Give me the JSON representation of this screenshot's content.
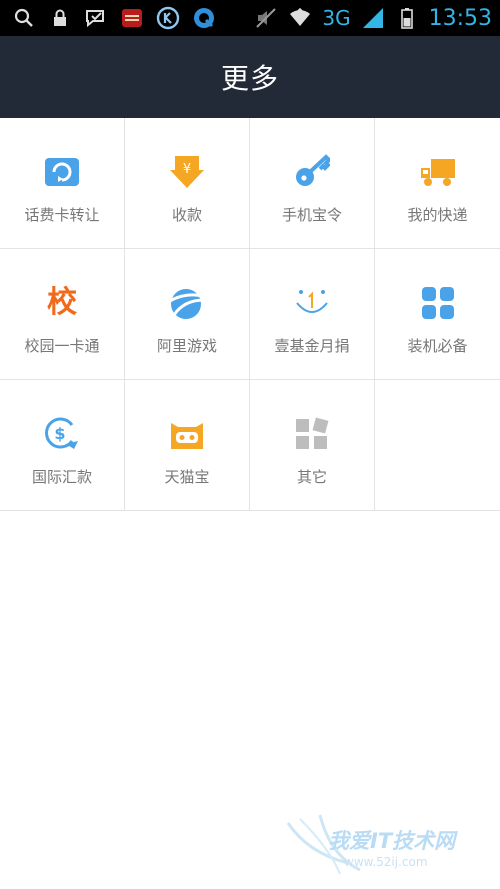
{
  "status_bar": {
    "network": "3G",
    "time": "13:53"
  },
  "header": {
    "title": "更多"
  },
  "grid_items": [
    {
      "label": "话费卡转让",
      "icon": "phone-card-transfer-icon"
    },
    {
      "label": "收款",
      "icon": "receive-money-icon"
    },
    {
      "label": "手机宝令",
      "icon": "key-icon"
    },
    {
      "label": "我的快递",
      "icon": "delivery-truck-icon"
    },
    {
      "label": "校园一卡通",
      "icon": "campus-card-icon",
      "icon_text": "校"
    },
    {
      "label": "阿里游戏",
      "icon": "ali-games-icon"
    },
    {
      "label": "壹基金月捐",
      "icon": "donation-smile-icon"
    },
    {
      "label": "装机必备",
      "icon": "apps-grid-icon"
    },
    {
      "label": "国际汇款",
      "icon": "international-remittance-icon"
    },
    {
      "label": "天猫宝",
      "icon": "tmall-bao-icon"
    },
    {
      "label": "其它",
      "icon": "other-icon"
    }
  ],
  "colors": {
    "title_bar": "#222a38",
    "status_accent": "#33b5e5",
    "blue_icon": "#4aa3e8",
    "orange_icon": "#f5a623",
    "campus_orange": "#f06a1a",
    "gray_icon": "#bdbdbd"
  },
  "watermark": {
    "text": "我爱IT技术网",
    "url": "www.52ij.com"
  }
}
